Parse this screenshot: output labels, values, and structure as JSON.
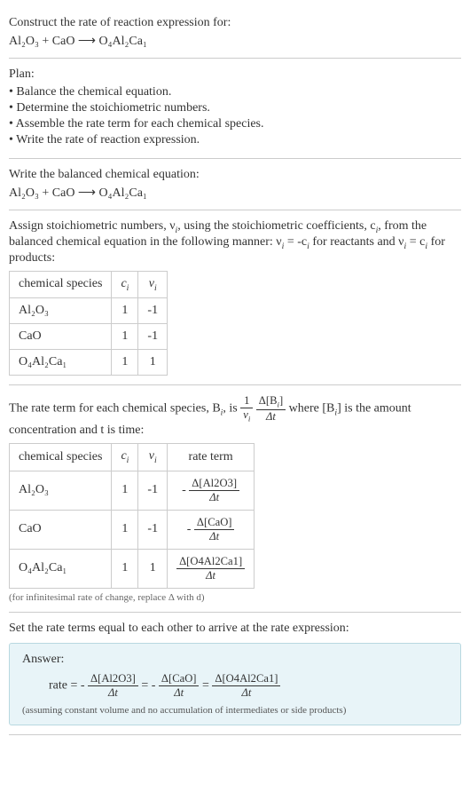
{
  "prompt": {
    "line1": "Construct the rate of reaction expression for:",
    "equation": "Al₂O₃ + CaO ⟶ O₄Al₂Ca₁"
  },
  "plan": {
    "title": "Plan:",
    "items": [
      "• Balance the chemical equation.",
      "• Determine the stoichiometric numbers.",
      "• Assemble the rate term for each chemical species.",
      "• Write the rate of reaction expression."
    ]
  },
  "balanced": {
    "title": "Write the balanced chemical equation:",
    "equation": "Al₂O₃ + CaO ⟶ O₄Al₂Ca₁"
  },
  "stoich": {
    "intro_a": "Assign stoichiometric numbers, ν",
    "intro_b": ", using the stoichiometric coefficients, c",
    "intro_c": ", from the balanced chemical equation in the following manner: ν",
    "intro_d": " = -c",
    "intro_e": " for reactants and ν",
    "intro_f": " = c",
    "intro_g": " for products:",
    "table": {
      "headers": [
        "chemical species",
        "cᵢ",
        "νᵢ"
      ],
      "rows": [
        {
          "species": "Al₂O₃",
          "c": "1",
          "v": "-1"
        },
        {
          "species": "CaO",
          "c": "1",
          "v": "-1"
        },
        {
          "species": "O₄Al₂Ca₁",
          "c": "1",
          "v": "1"
        }
      ]
    }
  },
  "rateterm": {
    "intro_a": "The rate term for each chemical species, B",
    "intro_b": ", is ",
    "frac1_num": "1",
    "frac1_den_a": "ν",
    "frac2_num_a": "Δ[B",
    "frac2_num_b": "]",
    "frac2_den": "Δt",
    "intro_c": " where [B",
    "intro_d": "] is the amount concentration and t is time:",
    "table": {
      "headers": [
        "chemical species",
        "cᵢ",
        "νᵢ",
        "rate term"
      ],
      "rows": [
        {
          "species": "Al₂O₃",
          "c": "1",
          "v": "-1",
          "neg": "-",
          "num": "Δ[Al2O3]",
          "den": "Δt"
        },
        {
          "species": "CaO",
          "c": "1",
          "v": "-1",
          "neg": "-",
          "num": "Δ[CaO]",
          "den": "Δt"
        },
        {
          "species": "O₄Al₂Ca₁",
          "c": "1",
          "v": "1",
          "neg": "",
          "num": "Δ[O4Al2Ca1]",
          "den": "Δt"
        }
      ]
    },
    "footnote": "(for infinitesimal rate of change, replace Δ with d)"
  },
  "final": {
    "title": "Set the rate terms equal to each other to arrive at the rate expression:",
    "answer_label": "Answer:",
    "rate_label": "rate = ",
    "neg": "-",
    "t1_num": "Δ[Al2O3]",
    "t1_den": "Δt",
    "eq": " = ",
    "t2_num": "Δ[CaO]",
    "t2_den": "Δt",
    "t3_num": "Δ[O4Al2Ca1]",
    "t3_den": "Δt",
    "note": "(assuming constant volume and no accumulation of intermediates or side products)"
  },
  "chart_data": {
    "type": "table",
    "title": "Stoichiometric coefficients and rate terms",
    "tables": [
      {
        "name": "stoichiometric_numbers",
        "columns": [
          "chemical species",
          "c_i",
          "nu_i"
        ],
        "rows": [
          [
            "Al2O3",
            1,
            -1
          ],
          [
            "CaO",
            1,
            -1
          ],
          [
            "O4Al2Ca1",
            1,
            1
          ]
        ]
      },
      {
        "name": "rate_terms",
        "columns": [
          "chemical species",
          "c_i",
          "nu_i",
          "rate term"
        ],
        "rows": [
          [
            "Al2O3",
            1,
            -1,
            "-Δ[Al2O3]/Δt"
          ],
          [
            "CaO",
            1,
            -1,
            "-Δ[CaO]/Δt"
          ],
          [
            "O4Al2Ca1",
            1,
            1,
            "Δ[O4Al2Ca1]/Δt"
          ]
        ]
      }
    ],
    "rate_expression": "rate = -Δ[Al2O3]/Δt = -Δ[CaO]/Δt = Δ[O4Al2Ca1]/Δt"
  }
}
